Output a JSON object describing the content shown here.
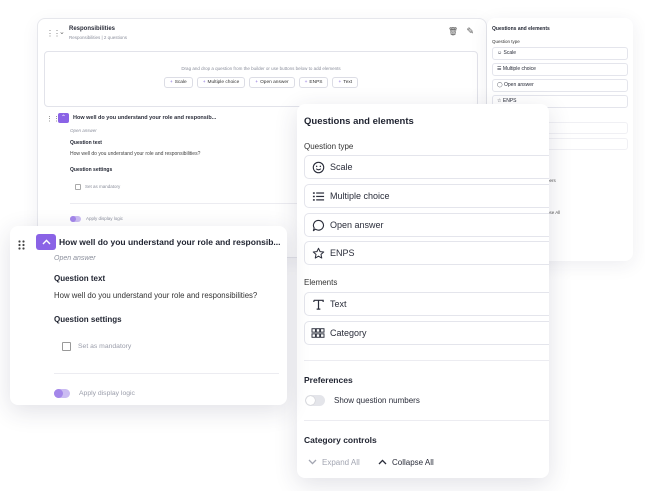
{
  "builder": {
    "section_title": "Responsibilities",
    "section_subtitle": "Responsibilities | 2 questions",
    "dropzone_hint": "Drag and drop a question from the builder or use buttons below to add elements",
    "add_buttons": [
      "Scale",
      "Multiple choice",
      "Open answer",
      "ENPS",
      "Text"
    ]
  },
  "question": {
    "title": "How well do you understand your role and responsibilities?",
    "type": "Open answer",
    "text_label": "Question text",
    "text_value": "How well do you understand your role and responsibilities?",
    "settings_label": "Question settings",
    "mandatory_label": "Set as mandatory",
    "display_logic_label": "Apply display logic"
  },
  "panel": {
    "title": "Questions and elements",
    "question_type_label": "Question type",
    "question_types": [
      {
        "label": "Scale",
        "icon": "smiley-icon"
      },
      {
        "label": "Multiple choice",
        "icon": "list-icon"
      },
      {
        "label": "Open answer",
        "icon": "speech-bubble-icon"
      },
      {
        "label": "ENPS",
        "icon": "star-icon"
      }
    ],
    "elements_label": "Elements",
    "elements": [
      {
        "label": "Text",
        "icon": "text-t-icon"
      },
      {
        "label": "Category",
        "icon": "category-grid-icon"
      }
    ],
    "preferences_label": "Preferences",
    "show_numbers_label": "Show question numbers",
    "category_controls_label": "Category controls",
    "expand_all": "Expand All",
    "collapse_all": "Collapse All"
  },
  "bg_panel": {
    "fragment_numbers": "bers",
    "fragment_collapse": "pse All"
  },
  "colors": {
    "accent": "#8a63e6",
    "text_dark": "#1f2330",
    "muted": "#9a9daa",
    "border": "#e4e5ec"
  }
}
